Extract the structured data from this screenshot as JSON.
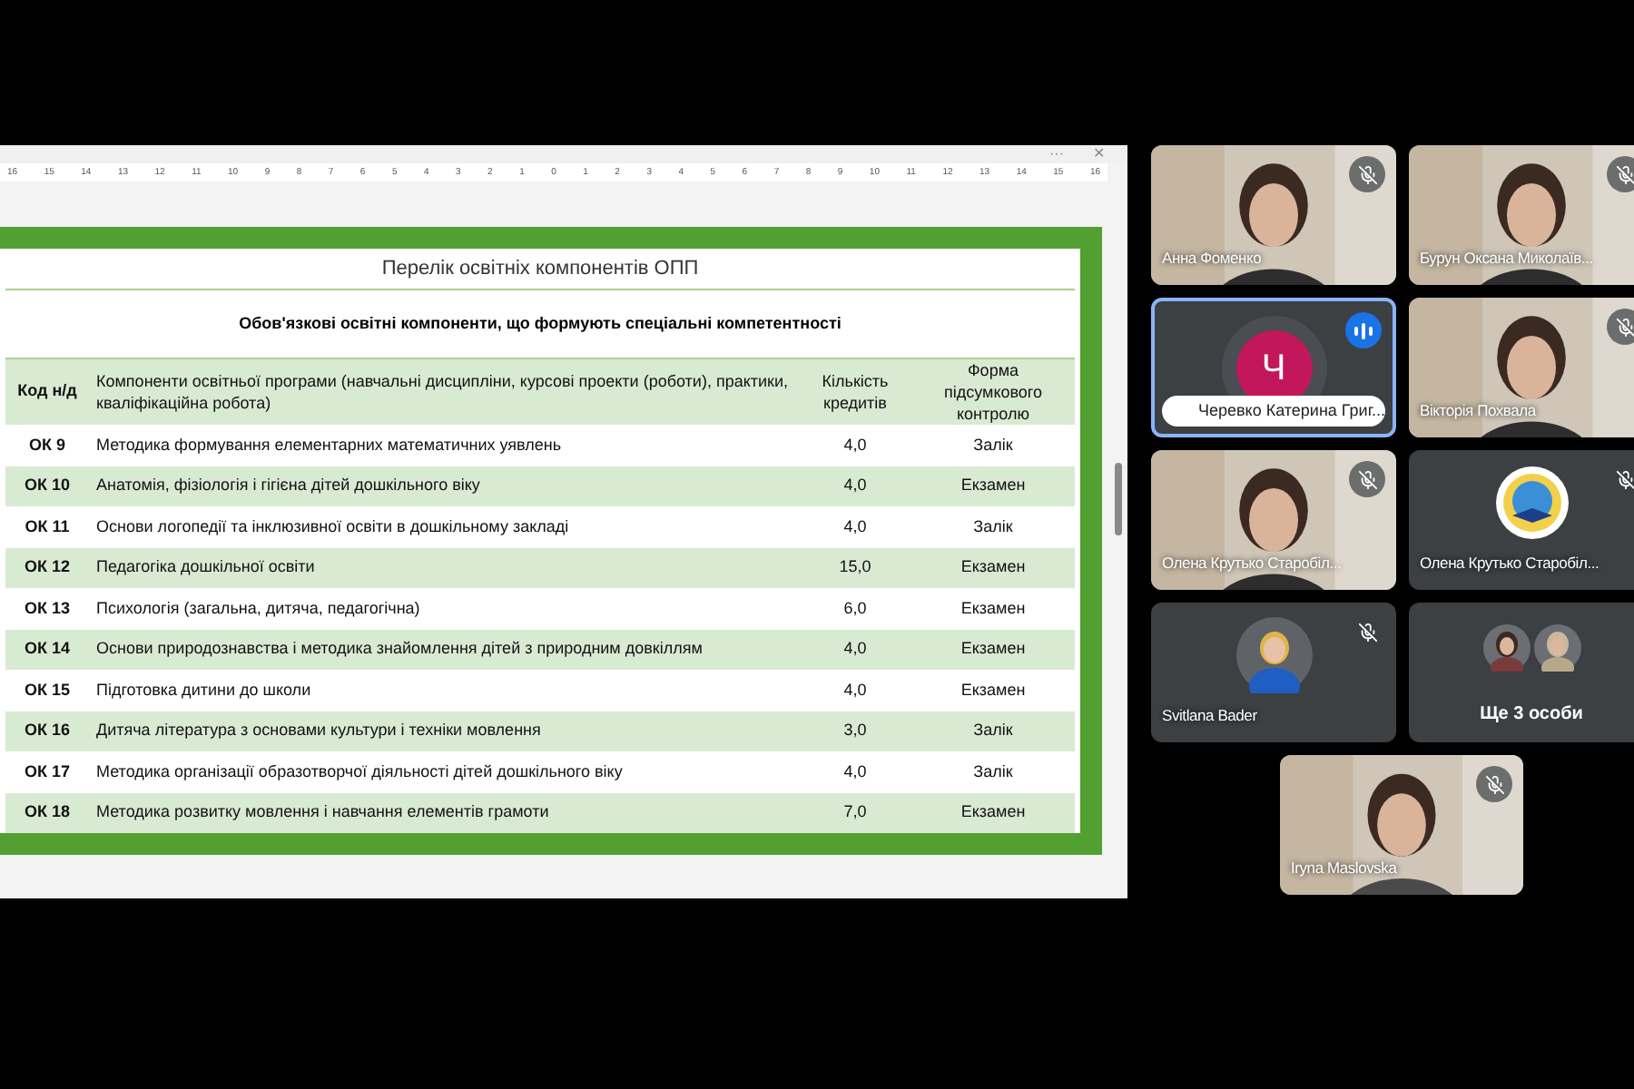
{
  "document": {
    "window_controls": [
      "···",
      "✕"
    ],
    "ruler": [
      "16",
      "15",
      "14",
      "13",
      "12",
      "11",
      "10",
      "9",
      "8",
      "7",
      "6",
      "5",
      "4",
      "3",
      "2",
      "1",
      "0",
      "1",
      "2",
      "3",
      "4",
      "5",
      "6",
      "7",
      "8",
      "9",
      "10",
      "11",
      "12",
      "13",
      "14",
      "15",
      "16"
    ],
    "title": "Перелік освітніх компонентів ОПП",
    "subtitle": "Обов'язкові освітні компоненти, що формують спеціальні компетентності",
    "columns": [
      "Код н/д",
      "Компоненти освітньої програми (навчальні дисципліни, курсові проекти (роботи), практики, кваліфікаційна робота)",
      "Кількість кредитів",
      "Форма підсумкового контролю"
    ],
    "rows": [
      {
        "code": "ОК 9",
        "name": "Методика формування елементарних математичних уявлень",
        "credits": "4,0",
        "form": "Залік"
      },
      {
        "code": "ОК 10",
        "name": "Анатомія, фізіологія і гігієна дітей дошкільного віку",
        "credits": "4,0",
        "form": "Екзамен"
      },
      {
        "code": "ОК 11",
        "name": "Основи логопедії та інклюзивної освіти в дошкільному закладі",
        "credits": "4,0",
        "form": "Залік"
      },
      {
        "code": "ОК 12",
        "name": "Педагогіка дошкільної освіти",
        "credits": "15,0",
        "form": "Екзамен"
      },
      {
        "code": "ОК 13",
        "name": "Психологія (загальна, дитяча, педагогічна)",
        "credits": "6,0",
        "form": "Екзамен"
      },
      {
        "code": "ОК 14",
        "name": "Основи природознавства і методика знайомлення дітей з природним довкіллям",
        "credits": "4,0",
        "form": "Екзамен"
      },
      {
        "code": "ОК 15",
        "name": "Підготовка дитини до школи",
        "credits": "4,0",
        "form": "Екзамен"
      },
      {
        "code": "ОК 16",
        "name": "Дитяча література з основами культури і техніки мовлення",
        "credits": "3,0",
        "form": "Залік"
      },
      {
        "code": "ОК 17",
        "name": "Методика організації образотворчої діяльності дітей дошкільного віку",
        "credits": "4,0",
        "form": "Залік"
      },
      {
        "code": "ОК 18",
        "name": "Методика розвитку мовлення і навчання елементів грамоти",
        "credits": "7,0",
        "form": "Екзамен"
      }
    ]
  },
  "participants": [
    {
      "name": "Анна Фоменко",
      "kind": "video",
      "muted": true,
      "speaking": false
    },
    {
      "name": "Бурун Оксана Миколаїв...",
      "kind": "video",
      "muted": true,
      "speaking": false
    },
    {
      "name": "Черевко Катерина Григ...",
      "kind": "letter",
      "initial": "Ч",
      "muted": false,
      "speaking": true
    },
    {
      "name": "Вікторія Похвала",
      "kind": "video",
      "muted": true,
      "speaking": false
    },
    {
      "name": "Олена Крутько Старобіл...",
      "kind": "video",
      "muted": true,
      "speaking": false
    },
    {
      "name": "Олена Крутько Старобіл...",
      "kind": "emblem",
      "muted": true,
      "speaking": false
    },
    {
      "name": "Svitlana Bader",
      "muted": true,
      "speaking": false
    },
    {
      "name": "Ще 3 особи",
      "kind": "group",
      "muted": false,
      "speaking": false
    }
  ],
  "featured": {
    "name": "Iryna Maslovska",
    "kind": "video",
    "muted": true,
    "speaking": false
  }
}
